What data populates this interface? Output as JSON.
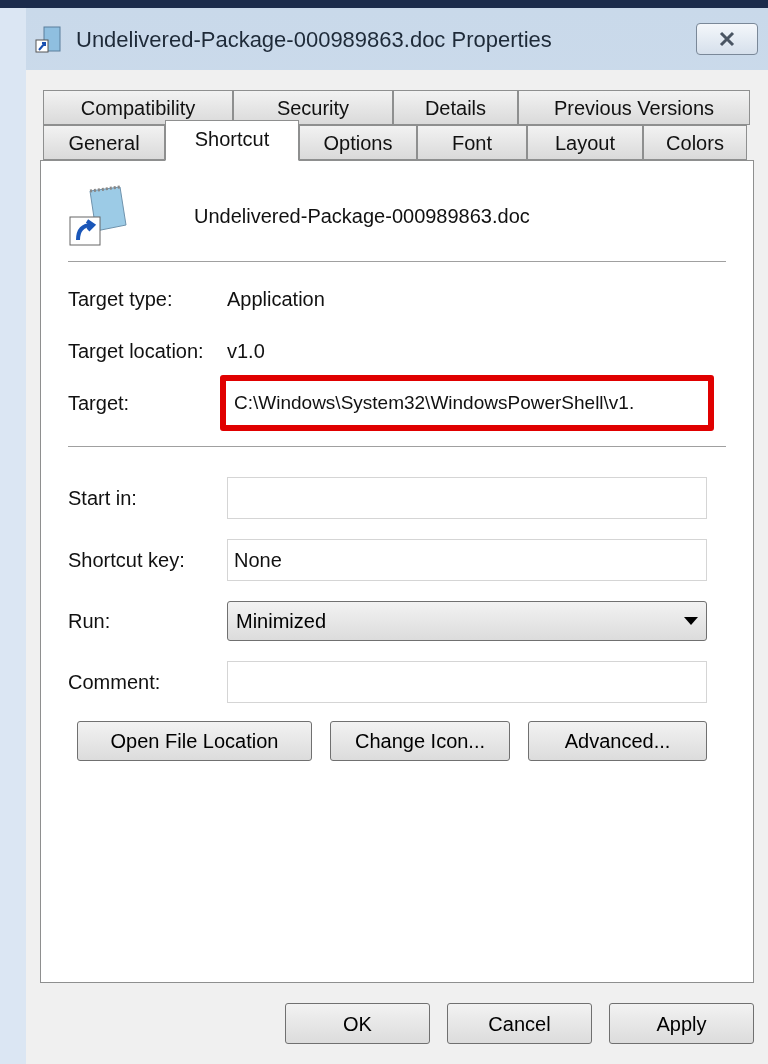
{
  "window": {
    "title": "Undelivered-Package-000989863.doc Properties"
  },
  "tabs": [
    [
      {
        "label": "Compatibility",
        "selected": false
      },
      {
        "label": "Security",
        "selected": false
      },
      {
        "label": "Details",
        "selected": false
      },
      {
        "label": "Previous Versions",
        "selected": false
      }
    ],
    [
      {
        "label": "General",
        "selected": false
      },
      {
        "label": "Shortcut",
        "selected": true
      },
      {
        "label": "Options",
        "selected": false
      },
      {
        "label": "Font",
        "selected": false
      },
      {
        "label": "Layout",
        "selected": false
      },
      {
        "label": "Colors",
        "selected": false
      }
    ]
  ],
  "file_name": "Undelivered-Package-000989863.doc",
  "info": [
    {
      "label": "Target type:",
      "value": "Application"
    },
    {
      "label": "Target location:",
      "value": "v1.0"
    }
  ],
  "target": {
    "label": "Target:",
    "value": "C:\\Windows\\System32\\WindowsPowerShell\\v1.",
    "highlighted": true
  },
  "fields": [
    {
      "kind": "text",
      "label": "Start in:"
    },
    {
      "kind": "text",
      "label": "Shortcut key:",
      "value": "None"
    },
    {
      "kind": "select",
      "label": "Run:",
      "value": "Minimized"
    },
    {
      "kind": "text",
      "label": "Comment:"
    }
  ],
  "actions": [
    "Open File Location",
    "Change Icon...",
    "Advanced..."
  ],
  "buttons": [
    "OK",
    "Cancel",
    "Apply"
  ]
}
